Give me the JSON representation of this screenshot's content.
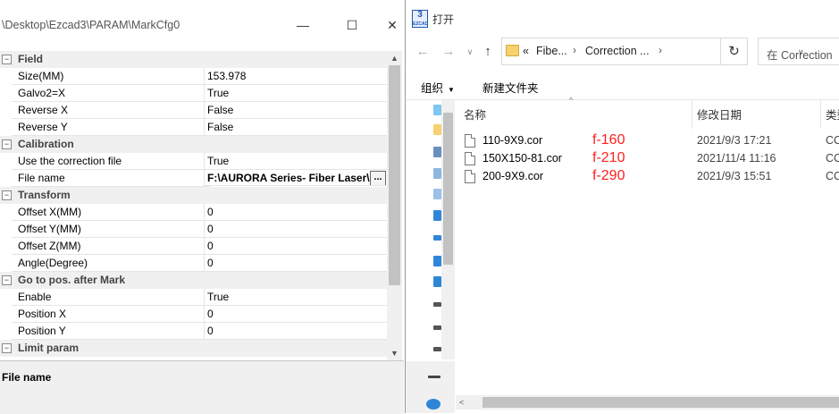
{
  "left_window": {
    "title": "\\Desktop\\Ezcad3\\PARAM\\MarkCfg0",
    "minimize_glyph": "—",
    "maximize_glyph": "☐",
    "close_glyph": "✕",
    "groups": [
      {
        "name": "Field",
        "expander": "⊟",
        "rows": [
          {
            "name": "Size(MM)",
            "value": "153.978"
          },
          {
            "name": "Galvo2=X",
            "value": "True"
          },
          {
            "name": "Reverse X",
            "value": "False"
          },
          {
            "name": "Reverse Y",
            "value": "False"
          }
        ]
      },
      {
        "name": "Calibration",
        "expander": "⊟",
        "rows": [
          {
            "name": "Use the correction file",
            "value": "True"
          },
          {
            "name": "File name",
            "value": "F:\\AURORA Series- Fiber Laser\\Au",
            "button": "..."
          }
        ]
      },
      {
        "name": "Transform",
        "expander": "⊟",
        "rows": [
          {
            "name": "Offset X(MM)",
            "value": "0"
          },
          {
            "name": "Offset Y(MM)",
            "value": "0"
          },
          {
            "name": "Offset Z(MM)",
            "value": "0"
          },
          {
            "name": "Angle(Degree)",
            "value": "0"
          }
        ]
      },
      {
        "name": "Go to pos. after Mark",
        "expander": "⊟",
        "rows": [
          {
            "name": "Enable",
            "value": "True"
          },
          {
            "name": "Position X",
            "value": "0"
          },
          {
            "name": "Position Y",
            "value": "0"
          }
        ]
      },
      {
        "name": "Limit param",
        "expander": "⊟",
        "rows": []
      }
    ],
    "description_title": "File name",
    "scroll_up": "▲",
    "scroll_down": "▼"
  },
  "open_dialog": {
    "app_icon_number": "3",
    "app_icon_label": "EZCAD",
    "title": "打开",
    "nav": {
      "back": "←",
      "forward": "→",
      "recent": "∨",
      "up": "↑"
    },
    "address": {
      "prefix": "«",
      "crumbs": [
        "Fibe...",
        "Correction ..."
      ],
      "separator": "›",
      "dropdown": "∨"
    },
    "refresh_glyph": "↻",
    "search_placeholder": "在 Correction",
    "toolbar": {
      "organize": "组织",
      "organize_dd": "▼",
      "new_folder": "新建文件夹"
    },
    "columns": {
      "name": "名称",
      "date": "修改日期",
      "type": "类型"
    },
    "sort_arrow": "^",
    "files": [
      {
        "name": "110-9X9.cor",
        "annotation": "f-160",
        "date": "2021/9/3 17:21",
        "type": "CC"
      },
      {
        "name": "150X150-81.cor",
        "annotation": "f-210",
        "date": "2021/11/4 11:16",
        "type": "CC"
      },
      {
        "name": "200-9X9.cor",
        "annotation": "f-290",
        "date": "2021/9/3 15:51",
        "type": "CC"
      }
    ],
    "hscroll_left": "<",
    "colors": {
      "annotation": "#ff2020",
      "folder": "#f5d26e",
      "accent": "#1a58b0"
    }
  }
}
